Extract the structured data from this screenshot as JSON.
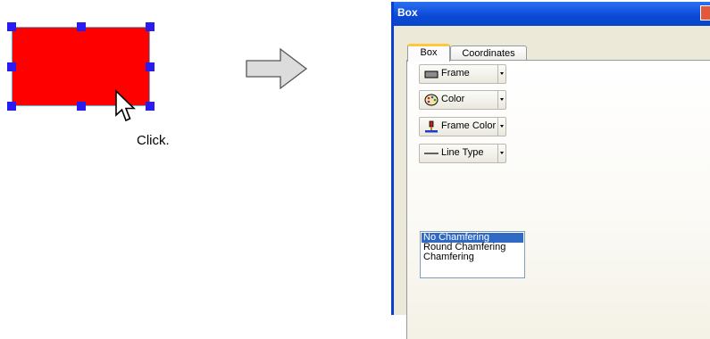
{
  "illustration": {
    "click_label": "Click.",
    "shape_fill": "#ff0000",
    "handle_color": "#2a1cf0"
  },
  "window": {
    "title": "Box",
    "close_icon": "close-icon",
    "tabs": [
      {
        "label": "Box",
        "active": true
      },
      {
        "label": "Coordinates",
        "active": false
      }
    ],
    "tools": [
      {
        "label": "Frame",
        "icon": "frame-icon"
      },
      {
        "label": "Color",
        "icon": "palette-icon"
      },
      {
        "label": "Frame Color",
        "icon": "paint-bucket-icon"
      },
      {
        "label": "Line Type",
        "icon": "line-type-icon"
      }
    ],
    "chamfer_list": {
      "options": [
        "No Chamfering",
        "Round Chamfering",
        "Chamfering"
      ],
      "selected": "No Chamfering"
    }
  },
  "colors": {
    "titlebar": "#0a48d6",
    "selection": "#316ac5",
    "active_tab_accent": "#ffc83c"
  }
}
